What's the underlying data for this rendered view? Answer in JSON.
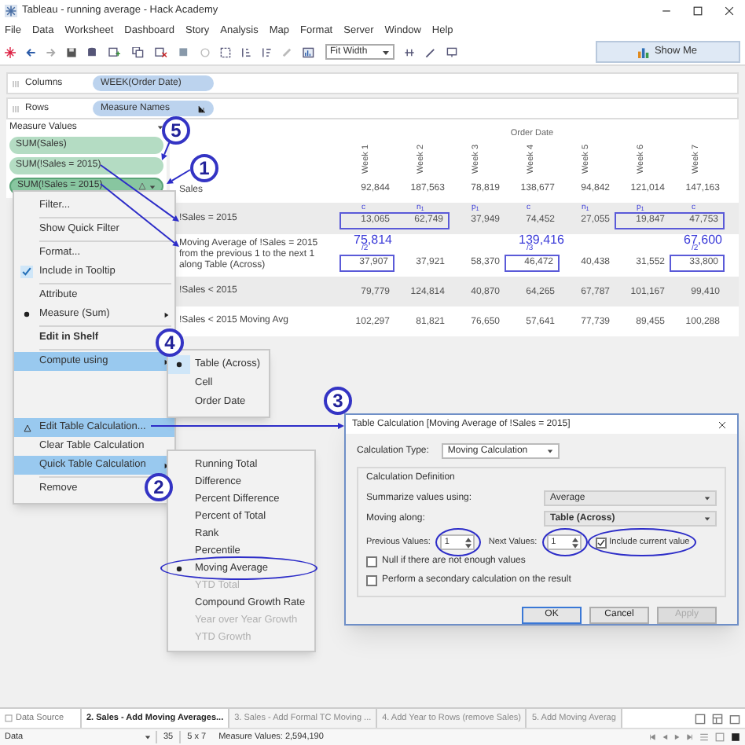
{
  "window": {
    "title": "Tableau - running average - Hack Academy"
  },
  "menu": [
    "File",
    "Data",
    "Worksheet",
    "Dashboard",
    "Story",
    "Analysis",
    "Map",
    "Format",
    "Server",
    "Window",
    "Help"
  ],
  "toolbar": {
    "fit": "Fit Width",
    "show_me": "Show Me"
  },
  "shelves": [
    {
      "label": "Columns",
      "pill": "WEEK(Order Date)",
      "sorted": false
    },
    {
      "label": "Rows",
      "pill": "Measure Names",
      "sorted": true
    }
  ],
  "measure_values": {
    "title": "Measure Values",
    "pills": [
      {
        "label": "SUM(Sales)",
        "selected": false,
        "warning": false
      },
      {
        "label": "SUM(!Sales = 2015)",
        "selected": false,
        "warning": false
      },
      {
        "label": "SUM(!Sales = 2015)",
        "selected": true,
        "warning": true
      }
    ]
  },
  "view": {
    "header": "Order Date",
    "columns": [
      "Week 1",
      "Week 2",
      "Week 3",
      "Week 4",
      "Week 5",
      "Week 6",
      "Week 7"
    ],
    "rows": [
      {
        "label": "Sales",
        "banded": false,
        "cells": [
          {
            "value": "92,844",
            "boxed": false
          },
          {
            "value": "187,563",
            "boxed": false
          },
          {
            "value": "78,819",
            "boxed": false
          },
          {
            "value": "138,677",
            "boxed": false
          },
          {
            "value": "94,842",
            "boxed": false
          },
          {
            "value": "121,014",
            "boxed": false
          },
          {
            "value": "147,163",
            "boxed": false
          }
        ]
      },
      {
        "label": "!Sales = 2015",
        "banded": true,
        "cells": [
          {
            "value": "13,065",
            "boxed": true,
            "tag": "c"
          },
          {
            "value": "62,749",
            "boxed": true,
            "tag": "n$_{1}$"
          },
          {
            "value": "37,949",
            "boxed": false,
            "tag": "p$_{1}$"
          },
          {
            "value": "74,452",
            "boxed": false,
            "tag": "c"
          },
          {
            "value": "27,055",
            "boxed": false,
            "tag": "n$_{1}$"
          },
          {
            "value": "19,847",
            "boxed": true,
            "tag": "p$_{1}$"
          },
          {
            "value": "47,753",
            "boxed": true,
            "tag": "c"
          }
        ]
      },
      {
        "label": "Moving Average of !Sales = 2015 from the previous 1 to the next 1 along Table (Across)",
        "banded": false,
        "cells": [
          {
            "value": "37,907",
            "boxed": true,
            "note": "75,814",
            "note_sub": "/2"
          },
          {
            "value": "37,921",
            "boxed": false
          },
          {
            "value": "58,370",
            "boxed": false
          },
          {
            "value": "46,472",
            "boxed": true,
            "note": "139,416",
            "note_sub": "/3"
          },
          {
            "value": "40,438",
            "boxed": false
          },
          {
            "value": "31,552",
            "boxed": false
          },
          {
            "value": "33,800",
            "boxed": true,
            "note": "67,600",
            "note_sub": "/2"
          }
        ]
      },
      {
        "label": "!Sales < 2015",
        "banded": true,
        "cells": [
          {
            "value": "79,779",
            "boxed": false
          },
          {
            "value": "124,814",
            "boxed": false
          },
          {
            "value": "40,870",
            "boxed": false
          },
          {
            "value": "64,265",
            "boxed": false
          },
          {
            "value": "67,787",
            "boxed": false
          },
          {
            "value": "101,167",
            "boxed": false
          },
          {
            "value": "99,410",
            "boxed": false
          }
        ]
      },
      {
        "label": "!Sales < 2015 Moving Avg",
        "banded": false,
        "cells": [
          {
            "value": "102,297",
            "boxed": false
          },
          {
            "value": "81,821",
            "boxed": false
          },
          {
            "value": "76,650",
            "boxed": false
          },
          {
            "value": "57,641",
            "boxed": false
          },
          {
            "value": "77,739",
            "boxed": false
          },
          {
            "value": "89,455",
            "boxed": false
          },
          {
            "value": "100,288",
            "boxed": false
          }
        ]
      }
    ]
  },
  "context_menu": [
    {
      "kind": "item",
      "label": "Filter...",
      "checked": false,
      "selected": false,
      "table_calc": false,
      "highlighted": false,
      "bold": false,
      "submenu": false
    },
    {
      "kind": "separator"
    },
    {
      "kind": "item",
      "label": "Show Quick Filter",
      "checked": false,
      "selected": false,
      "table_calc": false,
      "highlighted": false,
      "bold": false,
      "submenu": false
    },
    {
      "kind": "separator"
    },
    {
      "kind": "item",
      "label": "Format...",
      "checked": false,
      "selected": false,
      "table_calc": false,
      "highlighted": false,
      "bold": false,
      "submenu": false
    },
    {
      "kind": "item",
      "label": "Include in Tooltip",
      "checked": true,
      "selected": false,
      "table_calc": false,
      "highlighted": false,
      "bold": false,
      "submenu": false
    },
    {
      "kind": "separator"
    },
    {
      "kind": "item",
      "label": "Attribute",
      "checked": false,
      "selected": false,
      "table_calc": false,
      "highlighted": false,
      "bold": false,
      "submenu": false
    },
    {
      "kind": "item",
      "label": "Measure (Sum)",
      "checked": false,
      "selected": true,
      "table_calc": false,
      "highlighted": false,
      "bold": false,
      "submenu": true
    },
    {
      "kind": "separator"
    },
    {
      "kind": "item",
      "label": "Edit in Shelf",
      "checked": false,
      "selected": false,
      "table_calc": false,
      "highlighted": false,
      "bold": true,
      "submenu": false
    },
    {
      "kind": "separator"
    },
    {
      "kind": "item",
      "label": "Compute using",
      "checked": false,
      "selected": false,
      "table_calc": false,
      "highlighted": true,
      "bold": false,
      "submenu": true
    },
    {
      "kind": "spacer"
    },
    {
      "kind": "item",
      "label": "Edit Table Calculation...",
      "checked": false,
      "selected": false,
      "table_calc": true,
      "highlighted": true,
      "bold": false,
      "submenu": false
    },
    {
      "kind": "item",
      "label": "Clear Table Calculation",
      "checked": false,
      "selected": false,
      "table_calc": false,
      "highlighted": false,
      "bold": false,
      "submenu": false
    },
    {
      "kind": "item",
      "label": "Quick Table Calculation",
      "checked": false,
      "selected": false,
      "table_calc": false,
      "highlighted": true,
      "bold": false,
      "submenu": true
    },
    {
      "kind": "separator"
    },
    {
      "kind": "item",
      "label": "Remove",
      "checked": false,
      "selected": false,
      "table_calc": false,
      "highlighted": false,
      "bold": false,
      "submenu": false
    }
  ],
  "compute_using": [
    {
      "label": "Table (Across)",
      "selected": true
    },
    {
      "label": "Cell",
      "selected": false
    },
    {
      "label": "Order Date",
      "selected": false
    }
  ],
  "quick_table_calculation": [
    {
      "label": "Running Total",
      "selected": false,
      "disabled": false
    },
    {
      "label": "Difference",
      "selected": false,
      "disabled": false
    },
    {
      "label": "Percent Difference",
      "selected": false,
      "disabled": false
    },
    {
      "label": "Percent of Total",
      "selected": false,
      "disabled": false
    },
    {
      "label": "Rank",
      "selected": false,
      "disabled": false
    },
    {
      "label": "Percentile",
      "selected": false,
      "disabled": false
    },
    {
      "label": "Moving Average",
      "selected": true,
      "disabled": false
    },
    {
      "label": "YTD Total",
      "selected": false,
      "disabled": true
    },
    {
      "label": "Compound Growth Rate",
      "selected": false,
      "disabled": false
    },
    {
      "label": "Year over Year Growth",
      "selected": false,
      "disabled": true
    },
    {
      "label": "YTD Growth",
      "selected": false,
      "disabled": true
    }
  ],
  "dialog": {
    "title": "Table Calculation [Moving Average of !Sales = 2015]",
    "calc_type": {
      "label": "Calculation Type:",
      "value": "Moving Calculation"
    },
    "group": "Calculation Definition",
    "summarize": {
      "label": "Summarize values using:",
      "value": "Average"
    },
    "moving_along": {
      "label": "Moving along:",
      "value": "Table (Across)"
    },
    "previous": {
      "label": "Previous Values:",
      "value": "1"
    },
    "next": {
      "label": "Next Values:",
      "value": "1"
    },
    "include_current": {
      "label": "Include current value",
      "checked": true
    },
    "options": [
      {
        "label": "Null if there are not enough values",
        "checked": false
      },
      {
        "label": "Perform a secondary calculation on the result",
        "checked": false
      }
    ],
    "buttons": [
      {
        "label": "OK",
        "default": true,
        "disabled": false
      },
      {
        "label": "Cancel",
        "default": false,
        "disabled": false
      },
      {
        "label": "Apply",
        "default": false,
        "disabled": true
      }
    ]
  },
  "annotations": [
    "5",
    "1",
    "4",
    "3",
    "2"
  ],
  "tabs": {
    "data_source": "Data Source",
    "sheets": [
      {
        "label": "2. Sales - Add Moving Averages...",
        "selected": true
      },
      {
        "label": "3. Sales - Add Formal TC Moving ...",
        "selected": false
      },
      {
        "label": "4. Add Year to Rows (remove Sales)",
        "selected": false
      },
      {
        "label": "5. Add Moving Averag",
        "selected": false
      }
    ]
  },
  "status_bar": {
    "source": "Data",
    "marks": "35",
    "dims": "5 x 7",
    "sum": "Measure Values: 2,594,190"
  }
}
